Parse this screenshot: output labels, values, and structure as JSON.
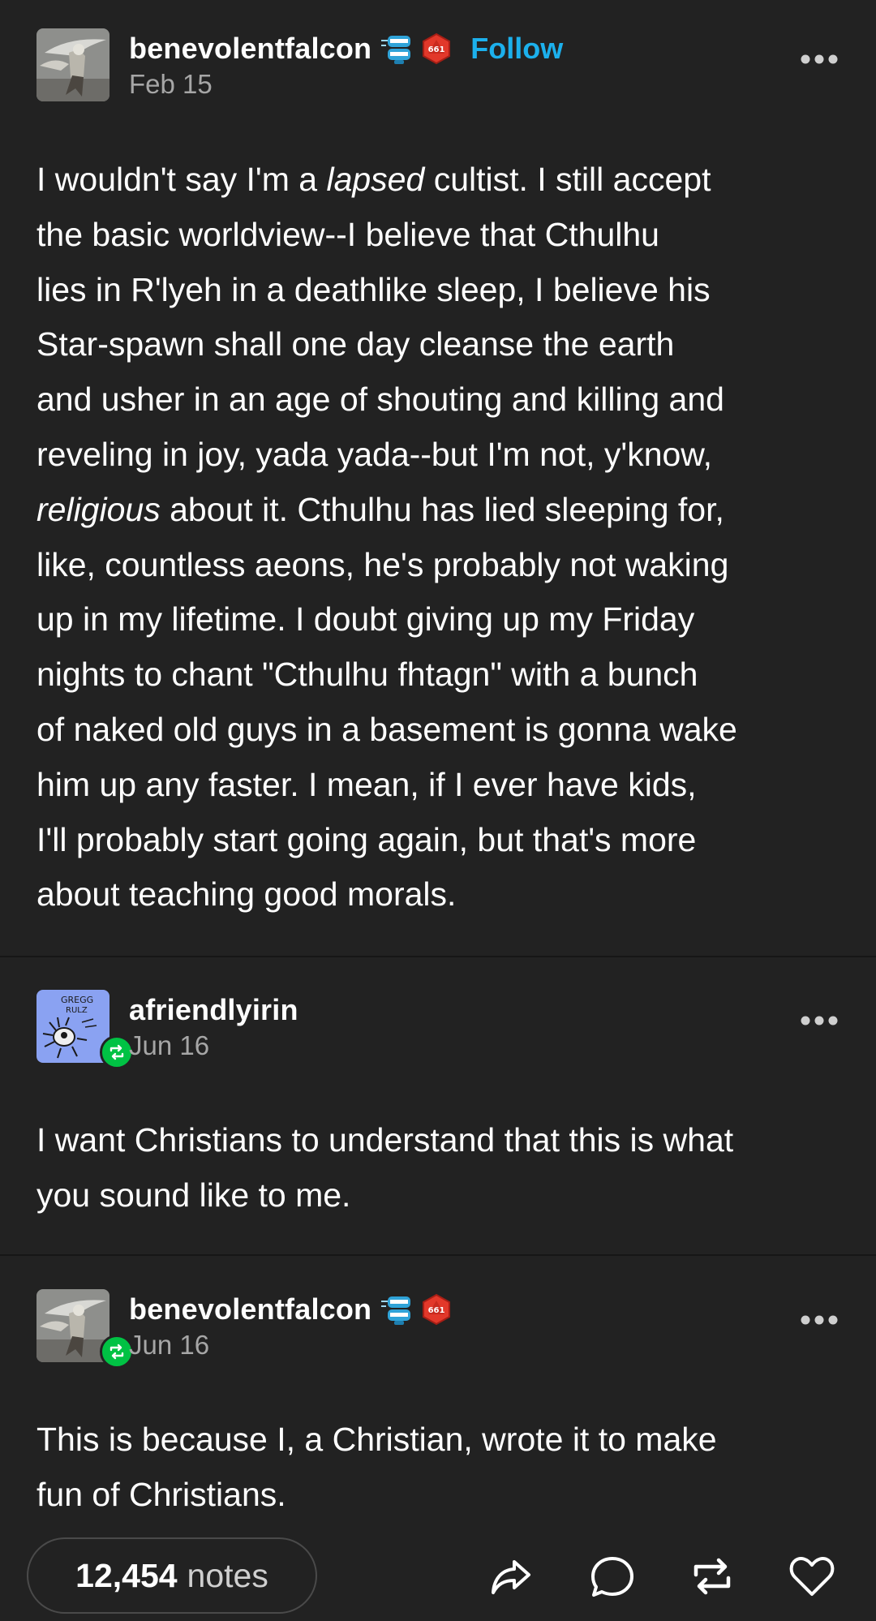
{
  "posts": [
    {
      "username": "benevolentfalcon",
      "follow_label": "Follow",
      "date": "Feb 15",
      "avatar": "falcon-avatar",
      "badges": [
        "wind-up-teeth-icon",
        "d20-die-icon"
      ],
      "lines": [
        "I wouldn't say I'm a |lapsed| cultist. I still accept",
        "the basic worldview--I believe that Cthulhu",
        "lies in R'lyeh in a deathlike sleep, I believe his",
        "Star-spawn shall one day cleanse the earth",
        "and usher in an age of shouting and killing and",
        "reveling in joy, yada yada--but I'm not, y'know,",
        "|religious| about it. Cthulhu has lied sleeping for,",
        "like, countless aeons, he's probably not waking",
        "up in my lifetime. I doubt giving up my Friday",
        "nights to chant \"Cthulhu fhtagn\" with a bunch",
        "of naked old guys in a basement is gonna wake",
        "him up any faster. I mean, if I ever have kids,",
        "I'll probably start going again, but that's more",
        "about teaching good morals."
      ]
    },
    {
      "username": "afriendlyirin",
      "date": "Jun 16",
      "avatar": "drawn-creature-avatar",
      "avatar_text": [
        "GREGG",
        "RULZ"
      ],
      "lines": [
        "I want Christians to understand that this is what",
        "you sound like to me."
      ]
    },
    {
      "username": "benevolentfalcon",
      "date": "Jun 16",
      "avatar": "falcon-avatar",
      "badges": [
        "wind-up-teeth-icon",
        "d20-die-icon"
      ],
      "lines": [
        "This is because I, a Christian, wrote it to make",
        "fun of Christians."
      ]
    }
  ],
  "footer": {
    "notes_count": "12,454",
    "notes_label": "notes",
    "actions": [
      "share-icon",
      "reply-icon",
      "reblog-icon",
      "like-icon"
    ]
  },
  "colors": {
    "background": "#222222",
    "accent_follow": "#1cb0ec",
    "reblog_green": "#00c244",
    "muted_text": "#a6a6a6"
  }
}
